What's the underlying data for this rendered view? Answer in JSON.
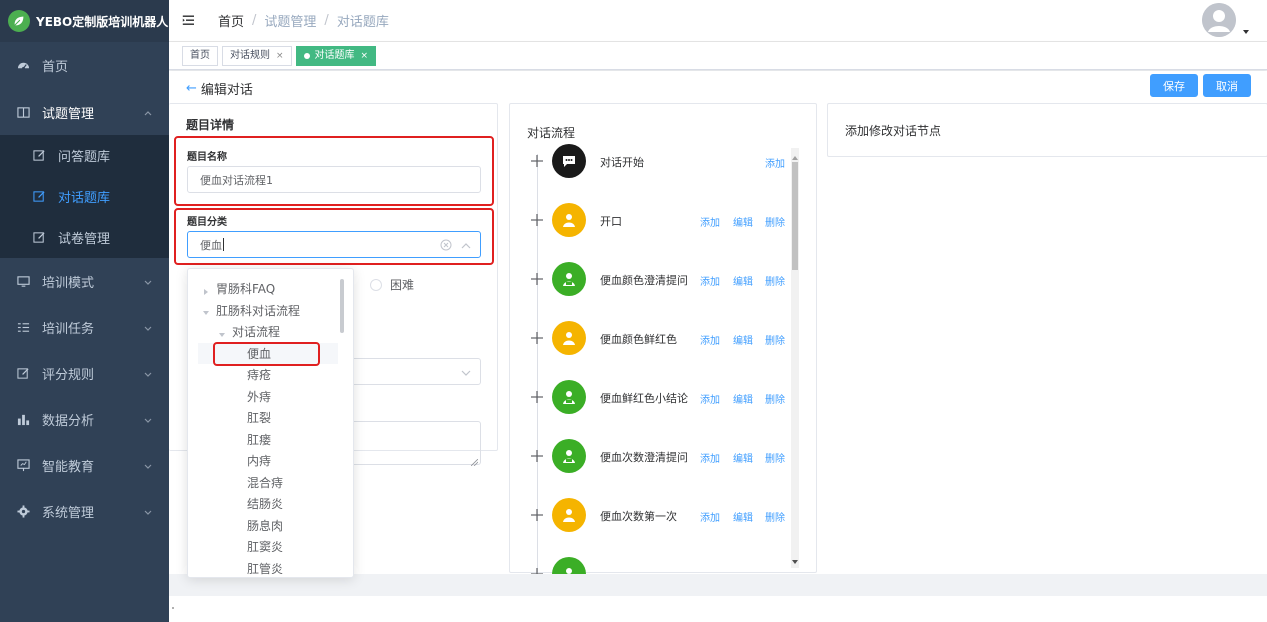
{
  "app": {
    "title": "YEBO定制版培训机器人",
    "brand_color": "#4caf50"
  },
  "sidebar": {
    "items": [
      {
        "label": "首页",
        "icon": "dashboard-icon"
      },
      {
        "label": "试题管理",
        "icon": "book-icon",
        "open": true
      },
      {
        "label": "培训模式",
        "icon": "monitor-icon"
      },
      {
        "label": "培训任务",
        "icon": "list-icon"
      },
      {
        "label": "评分规则",
        "icon": "edit-icon"
      },
      {
        "label": "数据分析",
        "icon": "bar-chart-icon"
      },
      {
        "label": "智能教育",
        "icon": "screen-icon"
      },
      {
        "label": "系统管理",
        "icon": "gear-icon"
      }
    ],
    "submenu": [
      {
        "label": "问答题库",
        "icon": "edit-icon"
      },
      {
        "label": "对话题库",
        "icon": "edit-icon",
        "active": true
      },
      {
        "label": "试卷管理",
        "icon": "edit-icon"
      }
    ]
  },
  "breadcrumb": {
    "home": "首页",
    "level1": "试题管理",
    "level2": "对话题库"
  },
  "tags": [
    {
      "label": "首页"
    },
    {
      "label": "对话规则",
      "closable": true
    },
    {
      "label": "对话题库",
      "closable": true,
      "active": true
    }
  ],
  "page": {
    "back_label": "编辑对话",
    "save_label": "保存",
    "cancel_label": "取消"
  },
  "details": {
    "title": "题目详情",
    "name_label": "题目名称",
    "name_value": "便血对话流程1",
    "category_label": "题目分类",
    "category_value": "便血",
    "difficulty_option": "困难"
  },
  "tree": [
    {
      "label": "胃肠科FAQ",
      "level": 0,
      "toggle": "collapsed"
    },
    {
      "label": "肛肠科对话流程",
      "level": 0,
      "toggle": "expanded"
    },
    {
      "label": "对话流程",
      "level": 1,
      "toggle": "expanded"
    },
    {
      "label": "便血",
      "level": 2,
      "selected": true
    },
    {
      "label": "痔疮",
      "level": 2
    },
    {
      "label": "外痔",
      "level": 2
    },
    {
      "label": "肛裂",
      "level": 2
    },
    {
      "label": "肛瘘",
      "level": 2
    },
    {
      "label": "内痔",
      "level": 2
    },
    {
      "label": "混合痔",
      "level": 2
    },
    {
      "label": "结肠炎",
      "level": 2
    },
    {
      "label": "肠息肉",
      "level": 2
    },
    {
      "label": "肛窦炎",
      "level": 2
    },
    {
      "label": "肛管炎",
      "level": 2
    }
  ],
  "flow": {
    "title": "对话流程",
    "add_label": "添加",
    "edit_label": "编辑",
    "delete_label": "删除",
    "nodes": [
      {
        "label": "对话开始",
        "color": "#1a1a1a",
        "icon": "chat-icon",
        "actions": [
          "add"
        ]
      },
      {
        "label": "开口",
        "color": "#f5b400",
        "icon": "user-icon",
        "actions": [
          "add",
          "edit",
          "delete"
        ]
      },
      {
        "label": "便血颜色澄清提问",
        "color": "#3bae26",
        "icon": "robot-icon",
        "actions": [
          "add",
          "edit",
          "delete"
        ]
      },
      {
        "label": "便血颜色鲜红色",
        "color": "#f5b400",
        "icon": "user-icon",
        "actions": [
          "add",
          "edit",
          "delete"
        ]
      },
      {
        "label": "便血鲜红色小结论",
        "color": "#3bae26",
        "icon": "robot-icon",
        "actions": [
          "add",
          "edit",
          "delete"
        ]
      },
      {
        "label": "便血次数澄清提问",
        "color": "#3bae26",
        "icon": "robot-icon",
        "actions": [
          "add",
          "edit",
          "delete"
        ]
      },
      {
        "label": "便血次数第一次",
        "color": "#f5b400",
        "icon": "user-icon",
        "actions": [
          "add",
          "edit",
          "delete"
        ]
      },
      {
        "label": "",
        "color": "#3bae26",
        "icon": "robot-icon",
        "actions": []
      }
    ]
  },
  "right_panel": {
    "title": "添加修改对话节点"
  },
  "colors": {
    "primary": "#409eff",
    "sidebar_bg": "#304156",
    "tag_active": "#42b983",
    "highlight": "#e02020"
  }
}
